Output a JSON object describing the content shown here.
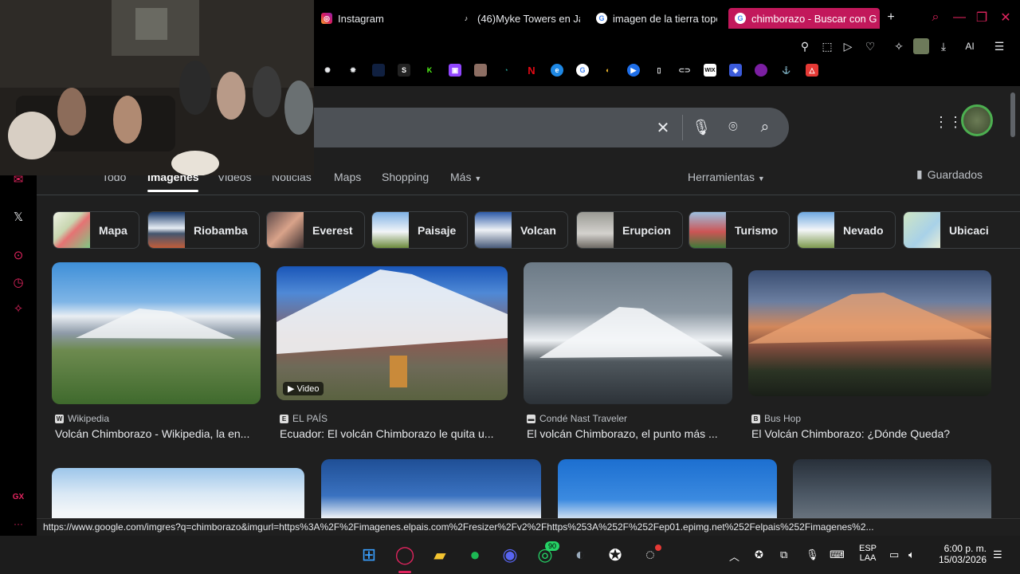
{
  "tabs": [
    {
      "label": "Instagram",
      "icon": "instagram-icon"
    },
    {
      "label": "(46)Myke Towers en Ja",
      "icon": "tiktok-icon"
    },
    {
      "label": "imagen de la tierra topo",
      "icon": "google-icon"
    },
    {
      "label": "chimborazo - Buscar con G",
      "icon": "google-icon",
      "active": true
    }
  ],
  "toolbar": {
    "ai_label": "AI"
  },
  "search": {
    "query": ""
  },
  "nav_tabs": [
    "Todo",
    "Imágenes",
    "Videos",
    "Noticias",
    "Maps",
    "Shopping",
    "Más"
  ],
  "tools_label": "Herramientas",
  "saved_label": "Guardados",
  "chips": [
    "Mapa",
    "Riobamba",
    "Everest",
    "Paisaje",
    "Volcan",
    "Erupcion",
    "Turismo",
    "Nevado",
    "Ubicaci"
  ],
  "results": [
    {
      "source": "Wikipedia",
      "title": "Volcán Chimborazo - Wikipedia, la en..."
    },
    {
      "source": "EL PAÍS",
      "title": "Ecuador: El volcán Chimborazo le quita u...",
      "badge": "Video"
    },
    {
      "source": "Condé Nast Traveler",
      "title": "El volcán Chimborazo, el punto más ..."
    },
    {
      "source": "Bus Hop",
      "title": "El Volcán Chimborazo: ¿Dónde Queda?"
    }
  ],
  "status_url": "https://www.google.com/imgres?q=chimborazo&imgurl=https%3A%2F%2Fimagenes.elpais.com%2Fresizer%2Fv2%2Fhttps%253A%252F%252Fep01.epimg.net%252Felpais%252Fimagenes%2...",
  "sidebar_label": "GX",
  "tray": {
    "lang_top": "ESP",
    "lang_bottom": "LAA",
    "time": "6:00 p. m.",
    "date": "15/03/2026",
    "whatsapp_badge": "90"
  },
  "colors": {
    "accent": "#e0245e",
    "page_bg": "#1f1f1f",
    "search_bg": "#4d5156"
  }
}
